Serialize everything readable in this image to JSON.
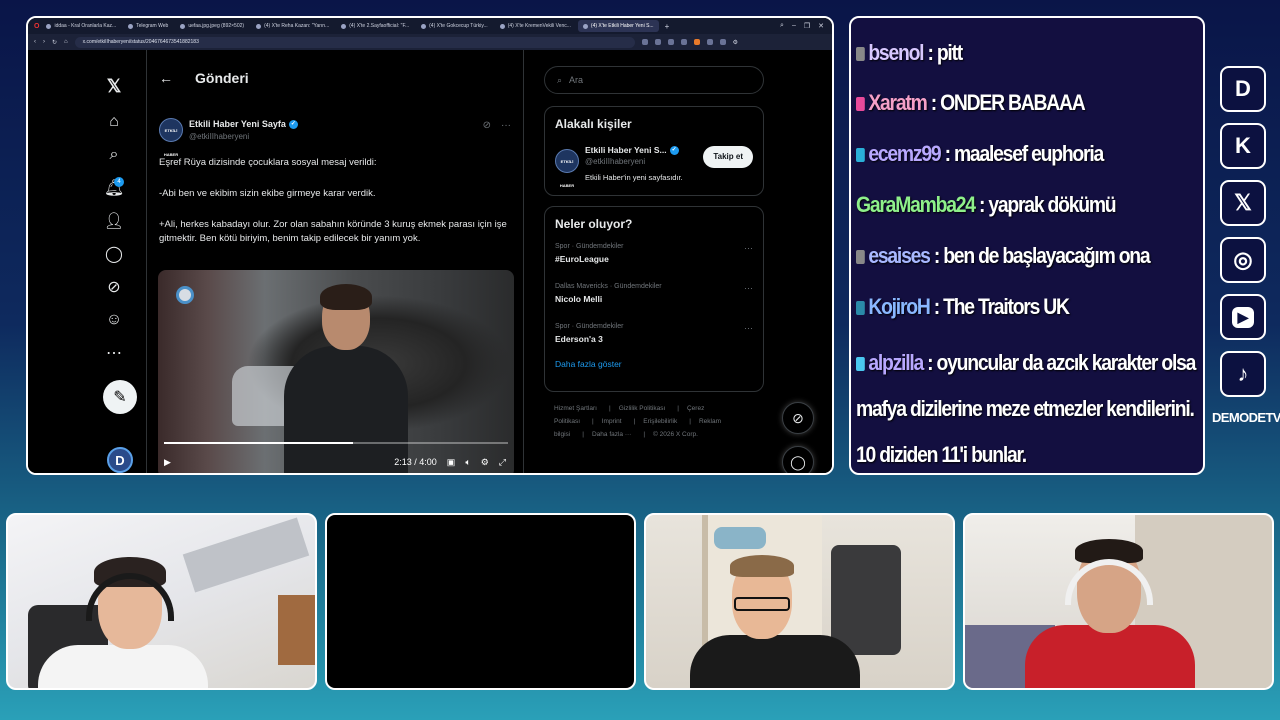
{
  "browser": {
    "tabs": [
      {
        "label": "iddaa - Kral Oranlarla Kaz...",
        "active": false
      },
      {
        "label": "Telegram Web",
        "active": false
      },
      {
        "label": "uefaa.jpg.jpeg (892×502)",
        "active": false
      },
      {
        "label": "(4) X'te Reha Kazan: \"Yarın...",
        "active": false
      },
      {
        "label": "(4) X'te 2.SayfaofficiaI: \"F...",
        "active": false
      },
      {
        "label": "(4) X'te Gokcecup Türkiy...",
        "active": false
      },
      {
        "label": "(4) X'te KremenVekili Venc...",
        "active": false
      },
      {
        "label": "(4) X'te Etkili Haber Yeni S...",
        "active": true
      }
    ],
    "url": "x.com/etkiIIhaberyeni/status/2046764673541882183",
    "x_sidebar": {
      "notification_count": "4"
    },
    "main": {
      "back_icon": "arrow-left-icon",
      "title": "Gönderi",
      "account_name": "Etkili Haber Yeni Sayfa",
      "account_handle": "@etkiIIhaberyeni",
      "avatar_text": "ETKİLİ HABER",
      "paragraphs": [
        "Eşref Rüya dizisinde çocuklara sosyal mesaj verildi:",
        "-Abi ben ve ekibim sizin ekibe girmeye karar verdik.",
        "+Ali, herkes kabadayı olur. Zor olan sabahın köründe 3 kuruş ekmek parası için işe gitmektir. Ben kötü biriyim, benim takip edilecek bir yanım yok."
      ],
      "video": {
        "time": "2:13 / 4:00",
        "progress": 0.55
      }
    },
    "right": {
      "search_placeholder": "Ara",
      "related_title": "Alakalı kişiler",
      "related_person": {
        "name": "Etkili Haber Yeni S...",
        "handle": "@etkiIIhaberyeni",
        "bio": "Etkili Haber'in yeni sayfasıdır.",
        "follow_label": "Takip et"
      },
      "trending_title": "Neler oluyor?",
      "trends": [
        {
          "meta": "Spor · Gündemdekiler",
          "name": "#EuroLeague"
        },
        {
          "meta": "Dallas Mavericks · Gündemdekiler",
          "name": "Nicolo Melli"
        },
        {
          "meta": "Spor · Gündemdekiler",
          "name": "Ederson'a 3"
        }
      ],
      "show_more": "Daha fazla göster",
      "footer": [
        "Hizmet Şartları",
        "Gizlilik Politikası",
        "Çerez Politikası",
        "Imprint",
        "Erişilebilirlik",
        "Reklam bilgisi",
        "Daha fazla ···",
        "© 2026 X Corp."
      ]
    }
  },
  "chat": [
    {
      "user": "bsenol",
      "text": " : pitt",
      "color": "#d8c8ff",
      "badge": "#888"
    },
    {
      "user": "Xaratm",
      "text": " : ONDER BABAAA",
      "color": "#f4a0c8",
      "badge": "#e84a9a"
    },
    {
      "user": "ecemz99",
      "text": " : maalesef euphoria",
      "color": "#b8a8ff",
      "badge": "#2ab0d8"
    },
    {
      "user": "GaraMamba24",
      "text": " : yaprak dökümü",
      "color": "#8ef08a",
      "badge": ""
    },
    {
      "user": "esaises",
      "text": " : ben de başlayacağım ona",
      "color": "#a8b8ff",
      "badge": "#888"
    },
    {
      "user": "KojiroH",
      "text": " : The Traitors UK",
      "color": "#8ab8ff",
      "badge": "#2a8aa8"
    },
    {
      "user": "alpzilla",
      "text": " : oyuncular da azcık karakter olsa mafya dizilerine meze etmezler kendilerini. 10 diziden 11'i bunlar.",
      "color": "#b8a8ff",
      "badge": "#4ac8f0"
    }
  ],
  "socials": {
    "items": [
      "demode-logo-icon",
      "kick-icon",
      "x-icon",
      "instagram-icon",
      "youtube-icon",
      "tiktok-icon"
    ],
    "label": "DEMODETV"
  }
}
